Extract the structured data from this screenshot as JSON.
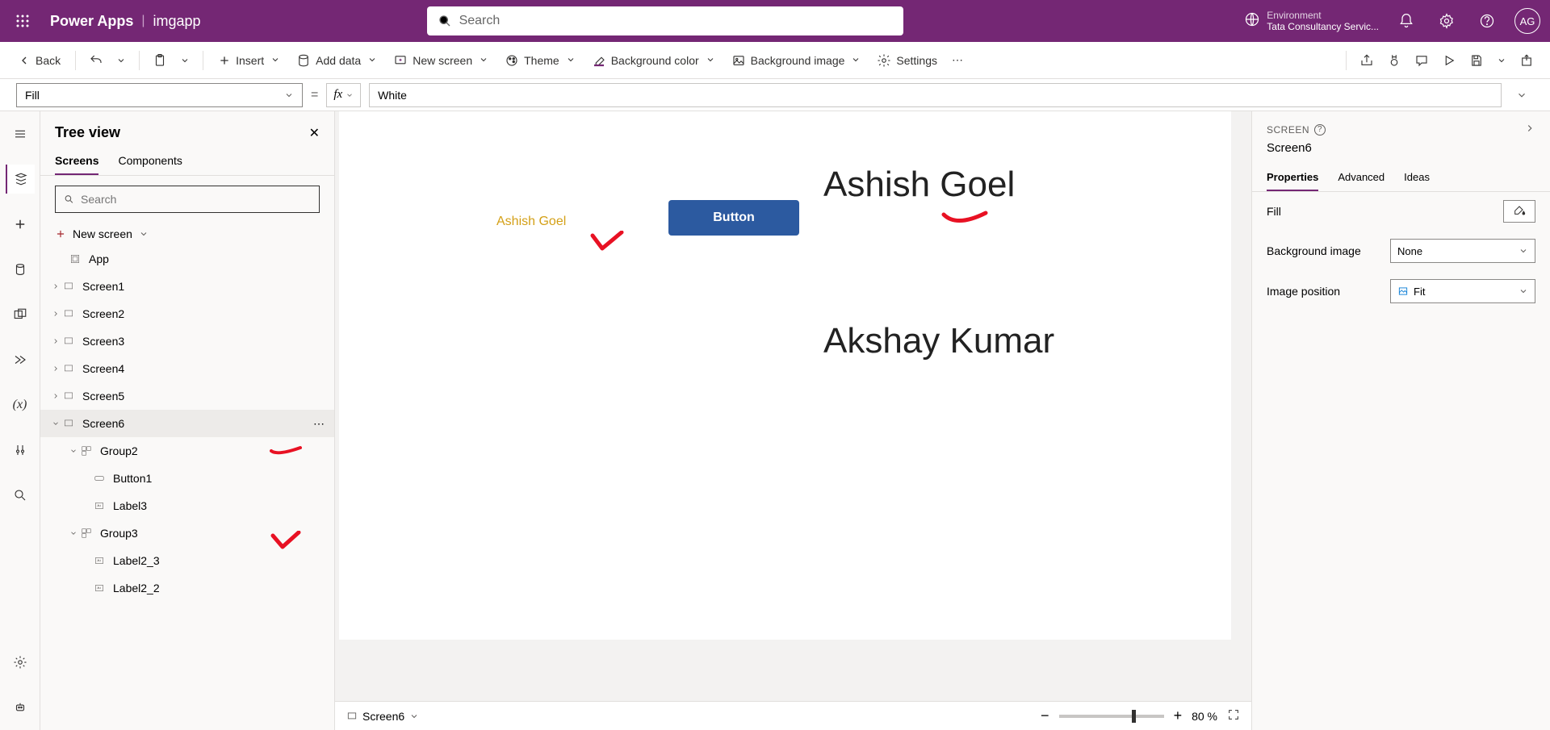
{
  "header": {
    "brand": "Power Apps",
    "app_name": "imgapp",
    "search_placeholder": "Search",
    "env_label": "Environment",
    "env_value": "Tata Consultancy Servic...",
    "avatar": "AG"
  },
  "cmdbar": {
    "back": "Back",
    "insert": "Insert",
    "add_data": "Add data",
    "new_screen": "New screen",
    "theme": "Theme",
    "bg_color": "Background color",
    "bg_image": "Background image",
    "settings": "Settings"
  },
  "formula": {
    "property": "Fill",
    "value": "White"
  },
  "tree": {
    "title": "Tree view",
    "tab_screens": "Screens",
    "tab_components": "Components",
    "search_placeholder": "Search",
    "new_screen": "New screen",
    "items": {
      "app": "App",
      "s1": "Screen1",
      "s2": "Screen2",
      "s3": "Screen3",
      "s4": "Screen4",
      "s5": "Screen5",
      "s6": "Screen6",
      "g2": "Group2",
      "btn1": "Button1",
      "lbl3": "Label3",
      "g3": "Group3",
      "l23": "Label2_3",
      "l22": "Label2_2"
    }
  },
  "canvas": {
    "label1": "Ashish Goel",
    "button": "Button",
    "label2": "Ashish Goel",
    "label3": "Akshay Kumar",
    "breadcrumb": "Screen6",
    "zoom": "80  %"
  },
  "rpanel": {
    "section": "SCREEN",
    "name": "Screen6",
    "tab_props": "Properties",
    "tab_adv": "Advanced",
    "tab_ideas": "Ideas",
    "fill": "Fill",
    "bg_img": "Background image",
    "bg_img_val": "None",
    "img_pos": "Image position",
    "img_pos_val": "Fit"
  }
}
